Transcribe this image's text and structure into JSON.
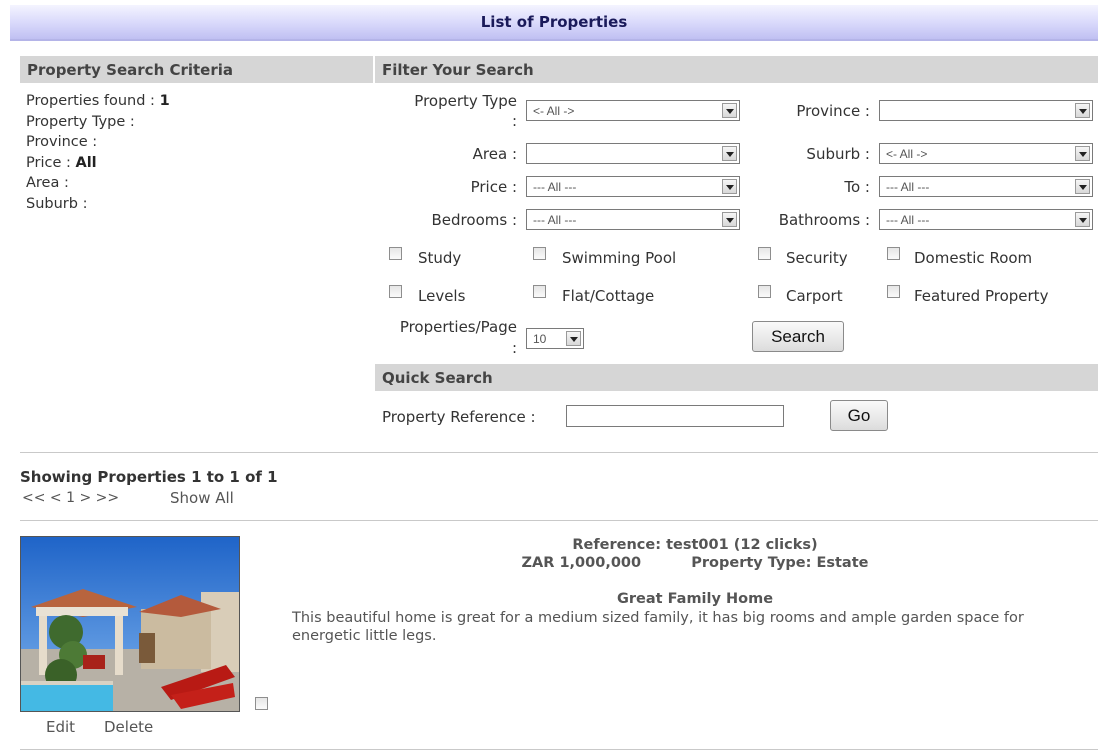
{
  "title": "List of Properties",
  "criteria": {
    "heading": "Property Search Criteria",
    "found_label": "Properties found :",
    "found_value": "1",
    "type_label": "Property Type :",
    "province_label": "Province :",
    "price_label": "Price :",
    "price_value": "All",
    "area_label": "Area :",
    "suburb_label": "Suburb :"
  },
  "filter": {
    "heading": "Filter Your Search",
    "property_type_label": "Property Type",
    "colon": ":",
    "property_type_value": "<- All ->",
    "province_label": "Province :",
    "province_value": "",
    "area_label": "Area :",
    "area_value": "",
    "suburb_label": "Suburb :",
    "suburb_value": "<- All ->",
    "price_label": "Price :",
    "price_value": "--- All ---",
    "to_label": "To :",
    "to_value": "--- All ---",
    "bedrooms_label": "Bedrooms :",
    "bedrooms_value": "--- All ---",
    "bathrooms_label": "Bathrooms :",
    "bathrooms_value": "--- All ---",
    "features": {
      "study": "Study",
      "pool": "Swimming Pool",
      "security": "Security",
      "domestic": "Domestic Room",
      "levels": "Levels",
      "flat": "Flat/Cottage",
      "carport": "Carport",
      "featured": "Featured Property"
    },
    "per_page_label": "Properties/Page",
    "per_page_value": "10",
    "search_button": "Search"
  },
  "quick": {
    "heading": "Quick Search",
    "ref_label": "Property Reference :",
    "ref_value": "",
    "go_button": "Go"
  },
  "results": {
    "showing": "Showing Properties 1 to 1 of 1",
    "pager": "<< < 1 > >>",
    "show_all": "Show All"
  },
  "listing": {
    "reference": "Reference: test001 (12 clicks)",
    "price": "ZAR 1,000,000",
    "type": "Property Type: Estate",
    "headline": "Great Family Home",
    "description": "This beautiful home is great for a medium sized family, it has big rooms and ample garden space for energetic little legs.",
    "edit": "Edit",
    "delete": "Delete"
  },
  "colors": {
    "title_bar": "#d8d8fb",
    "section_header": "#d6d6d6"
  }
}
